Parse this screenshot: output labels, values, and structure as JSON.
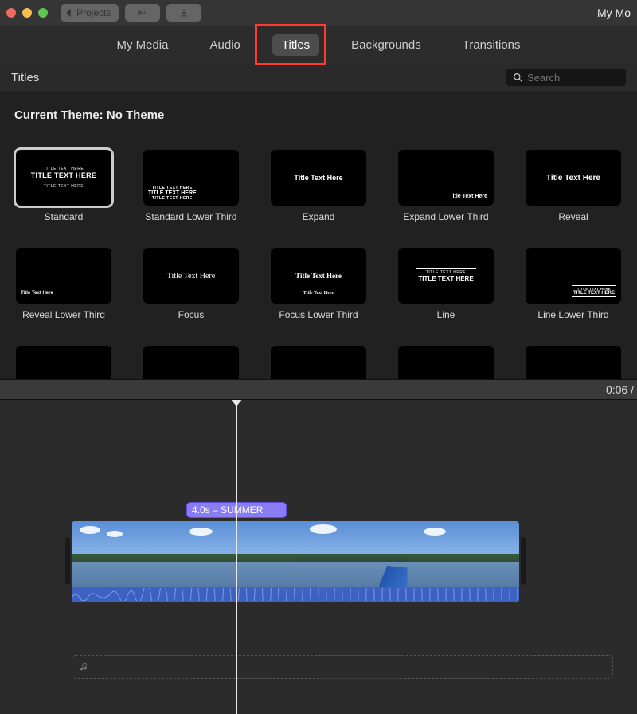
{
  "toolbar": {
    "projects_label": "Projects",
    "project_title": "My Mo"
  },
  "nav": {
    "items": [
      {
        "label": "My Media"
      },
      {
        "label": "Audio"
      },
      {
        "label": "Titles",
        "active": true
      },
      {
        "label": "Backgrounds"
      },
      {
        "label": "Transitions"
      }
    ]
  },
  "browser": {
    "title": "Titles",
    "search_placeholder": "Search",
    "theme_prefix": "Current Theme: ",
    "theme_name": "No Theme"
  },
  "tiles": [
    {
      "label": "Standard",
      "style": "center-triple",
      "selected": true
    },
    {
      "label": "Standard Lower Third",
      "style": "lower-left-triple"
    },
    {
      "label": "Expand",
      "style": "center-single"
    },
    {
      "label": "Expand Lower Third",
      "style": "lower-right-single"
    },
    {
      "label": "Reveal",
      "style": "center-single-bold"
    },
    {
      "label": "Reveal Lower Third",
      "style": "lower-left-single"
    },
    {
      "label": "Focus",
      "style": "center-serif"
    },
    {
      "label": "Focus Lower Third",
      "style": "center-serif-lower"
    },
    {
      "label": "Line",
      "style": "center-line"
    },
    {
      "label": "Line Lower Third",
      "style": "lower-right-line"
    }
  ],
  "tile_text": {
    "main": "TITLE TEXT HERE",
    "sub": "TITLE TEXT HERE",
    "serif": "Title Text Here"
  },
  "timecode": "0:06 /",
  "timeline": {
    "title_clip_label": "4.0s – SUMMER"
  },
  "colors": {
    "highlight": "#ff3b30",
    "title_clip": "#8b7cf5"
  }
}
